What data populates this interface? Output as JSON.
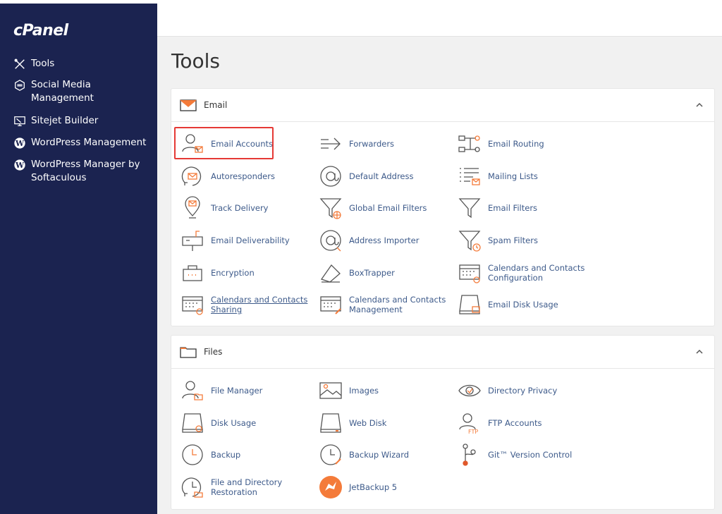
{
  "brand": {
    "logo": "cPanel"
  },
  "sidebar": {
    "items": [
      {
        "label": "Tools",
        "icon": "tools-icon"
      },
      {
        "label": "Social Media\nManagement",
        "icon": "social-media-icon"
      },
      {
        "label": "Sitejet Builder",
        "icon": "sitejet-icon"
      },
      {
        "label": "WordPress Management",
        "icon": "wordpress-icon"
      },
      {
        "label": "WordPress Manager by\nSoftaculous",
        "icon": "wordpress-icon"
      }
    ]
  },
  "page": {
    "title": "Tools"
  },
  "sections": {
    "email": {
      "title": "Email",
      "items": [
        {
          "label": "Email Accounts",
          "icon": "email-accounts-icon"
        },
        {
          "label": "Forwarders",
          "icon": "forwarders-icon"
        },
        {
          "label": "Email Routing",
          "icon": "email-routing-icon"
        },
        {
          "label": "Autoresponders",
          "icon": "autoresponders-icon"
        },
        {
          "label": "Default Address",
          "icon": "default-address-icon"
        },
        {
          "label": "Mailing Lists",
          "icon": "mailing-lists-icon"
        },
        {
          "label": "Track Delivery",
          "icon": "track-delivery-icon"
        },
        {
          "label": "Global Email Filters",
          "icon": "global-email-filters-icon"
        },
        {
          "label": "Email Filters",
          "icon": "email-filters-icon"
        },
        {
          "label": "Email Deliverability",
          "icon": "email-deliverability-icon"
        },
        {
          "label": "Address Importer",
          "icon": "address-importer-icon"
        },
        {
          "label": "Spam Filters",
          "icon": "spam-filters-icon"
        },
        {
          "label": "Encryption",
          "icon": "encryption-icon"
        },
        {
          "label": "BoxTrapper",
          "icon": "boxtrapper-icon"
        },
        {
          "label": "Calendars and Contacts\nConfiguration",
          "icon": "calendar-config-icon"
        },
        {
          "label": "Calendars and Contacts\nSharing",
          "icon": "calendar-sharing-icon"
        },
        {
          "label": "Calendars and Contacts\nManagement",
          "icon": "calendar-management-icon"
        },
        {
          "label": "Email Disk Usage",
          "icon": "email-disk-usage-icon"
        }
      ]
    },
    "files": {
      "title": "Files",
      "items": [
        {
          "label": "File Manager",
          "icon": "file-manager-icon"
        },
        {
          "label": "Images",
          "icon": "images-icon"
        },
        {
          "label": "Directory Privacy",
          "icon": "directory-privacy-icon"
        },
        {
          "label": "Disk Usage",
          "icon": "disk-usage-icon"
        },
        {
          "label": "Web Disk",
          "icon": "web-disk-icon"
        },
        {
          "label": "FTP Accounts",
          "icon": "ftp-accounts-icon"
        },
        {
          "label": "Backup",
          "icon": "backup-icon"
        },
        {
          "label": "Backup Wizard",
          "icon": "backup-wizard-icon"
        },
        {
          "label": "Git™ Version Control",
          "icon": "git-icon"
        },
        {
          "label": "File and Directory\nRestoration",
          "icon": "file-restoration-icon"
        },
        {
          "label": "JetBackup 5",
          "icon": "jetbackup-icon"
        }
      ]
    }
  },
  "colors": {
    "sidebar": "#1b2350",
    "accent": "#f47b3a",
    "link": "#3d5a8a",
    "highlight": "#e53935"
  }
}
